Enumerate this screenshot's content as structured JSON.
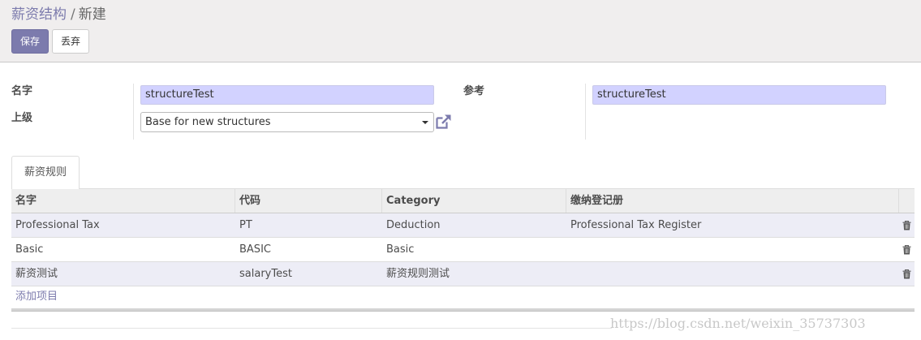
{
  "breadcrumb": {
    "parent": "薪资结构",
    "separator": "/",
    "current": "新建"
  },
  "toolbar": {
    "save_label": "保存",
    "discard_label": "丢弃"
  },
  "form": {
    "name_label": "名字",
    "name_value": "structureTest",
    "parent_label": "上级",
    "parent_value": "Base for new structures",
    "reference_label": "参考",
    "reference_value": "structureTest"
  },
  "tabs": [
    {
      "label": "薪资规则",
      "active": true
    }
  ],
  "rules_table": {
    "columns": [
      "名字",
      "代码",
      "Category",
      "缴纳登记册"
    ],
    "rows": [
      {
        "name": "Professional Tax",
        "code": "PT",
        "category": "Deduction",
        "register": "Professional Tax Register"
      },
      {
        "name": "Basic",
        "code": "BASIC",
        "category": "Basic",
        "register": ""
      },
      {
        "name": "薪资测试",
        "code": "salaryTest",
        "category": "薪资规则测试",
        "register": ""
      }
    ],
    "add_line_label": "添加项目"
  },
  "icons": {
    "external_link": "external-link-icon",
    "delete": "trash-icon",
    "dropdown": "caret-down-icon"
  },
  "colors": {
    "accent": "#7c7bad",
    "required_field": "#d2d2ff",
    "odd_row": "#ededf6"
  },
  "watermark": "https://blog.csdn.net/weixin_35737303"
}
